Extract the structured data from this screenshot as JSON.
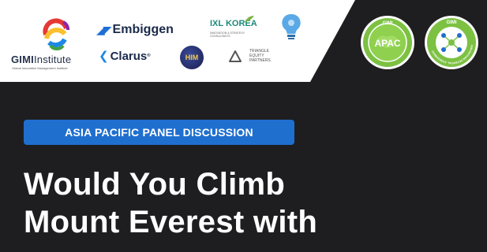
{
  "logos": {
    "gimi": {
      "name_bold": "GIMI",
      "name_light": "nstitute",
      "subtitle": "Global Innovation Management Institute"
    },
    "embiggen": {
      "name": "Embiggen"
    },
    "ixl": {
      "name": "IXL KOREA",
      "subtitle": "INNOVATION & STRATEGY CONSULTANTS"
    },
    "clarus": {
      "name": "Clarus"
    },
    "him": {
      "name": "HIM"
    },
    "triangle": {
      "line1": "TRIANGLE",
      "line2": "EQUITY",
      "line3": "PARTNERS"
    }
  },
  "badges": [
    {
      "top": "GIMI",
      "center": "APAC"
    },
    {
      "top": "GIMI",
      "ring": "INNOVATION POTENTIAL ASSESSMENT"
    }
  ],
  "event": {
    "label": "ASIA PACIFIC PANEL DISCUSSION",
    "headline_lines": [
      "Would You Climb",
      "Mount Everest with"
    ]
  },
  "colors": {
    "dark_bg": "#1e1e20",
    "accent_blue": "#1f6fcf",
    "badge_green": "#4caf50"
  }
}
